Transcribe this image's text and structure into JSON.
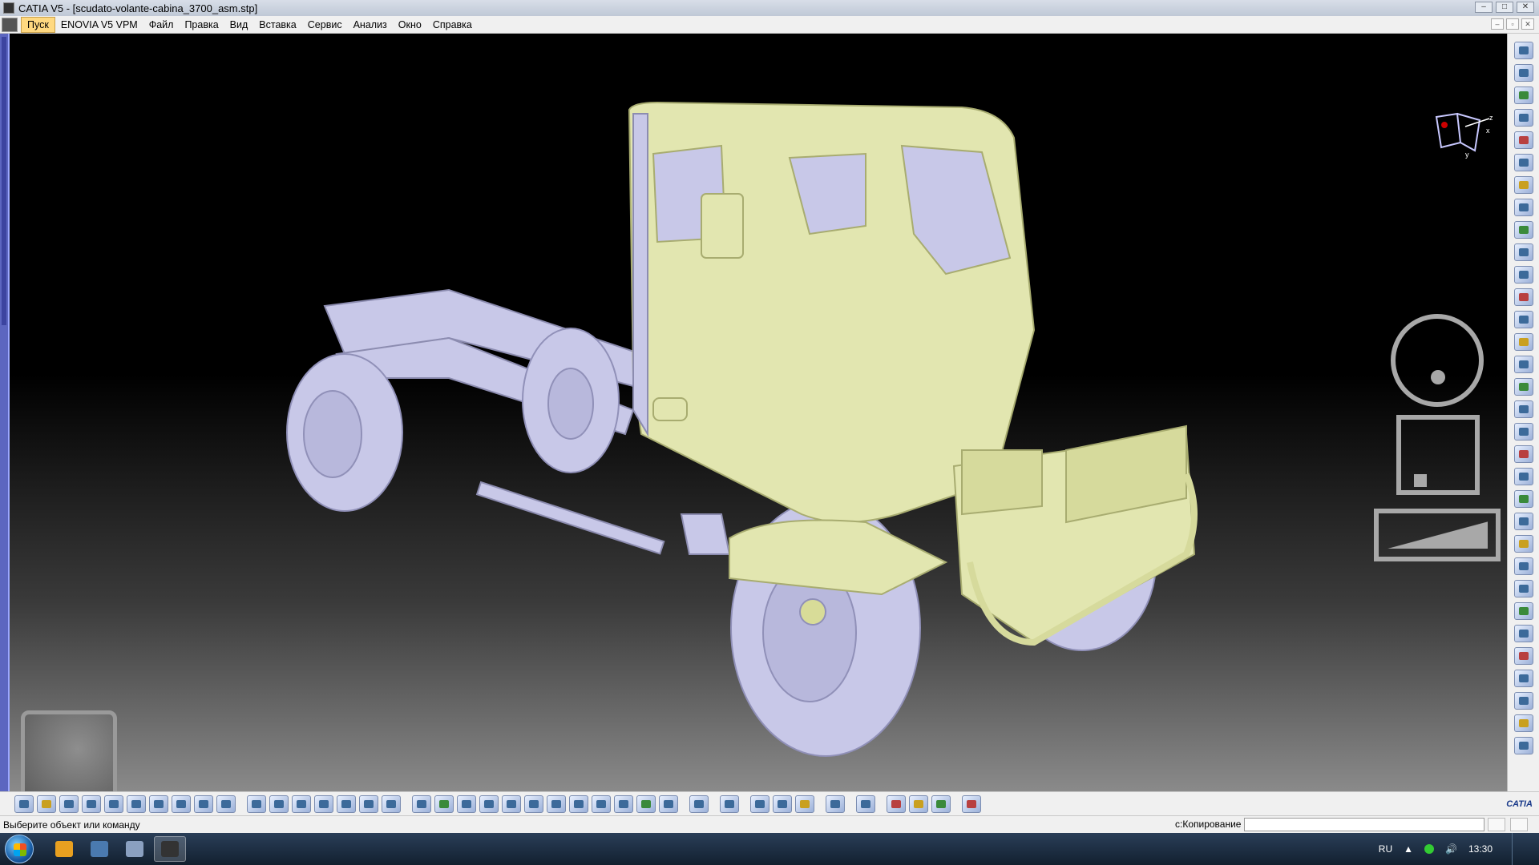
{
  "window": {
    "title": "CATIA V5 - [scudato-volante-cabina_3700_asm.stp]"
  },
  "menu": {
    "items": [
      "Пуск",
      "ENOVIA V5 VPM",
      "Файл",
      "Правка",
      "Вид",
      "Вставка",
      "Сервис",
      "Анализ",
      "Окно",
      "Справка"
    ]
  },
  "compass": {
    "axis_x": "x",
    "axis_y": "y",
    "axis_z": "z"
  },
  "statusbar": {
    "message": "Выберите объект или команду",
    "command_label": "с:Копирование",
    "command_value": ""
  },
  "brand": {
    "logo_text": "CATIA"
  },
  "taskbar": {
    "lang": "RU",
    "clock": "13:30"
  },
  "colors": {
    "cab": "#e2e6b0",
    "chassis": "#c8c8e8",
    "accent": "#ffd980"
  }
}
